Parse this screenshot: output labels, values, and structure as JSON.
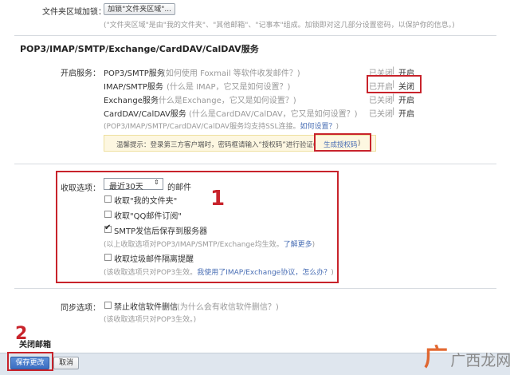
{
  "folder_encrypt": {
    "label": "文件夹区域加锁：",
    "button": "加锁\"文件夹区域\"...",
    "desc": "(\"文件夹区域\"是由\"我的文件夹\"、\"其他邮箱\"、\"记事本\"组成。加锁即对这几部分设置密码，以保护你的信息。)"
  },
  "protocol_section": {
    "title": "POP3/IMAP/SMTP/Exchange/CardDAV/CalDAV服务",
    "open_label": "开启服务：",
    "services": [
      {
        "name": "POP3/SMTP服务",
        "help": "(如何使用 Foxmail 等软件收发邮件？)",
        "status": "已关闭",
        "action": "开启"
      },
      {
        "name": "IMAP/SMTP服务",
        "help": "(什么是 IMAP，它又是如何设置？)",
        "status": "已开启",
        "action": "关闭"
      },
      {
        "name": "Exchange服务",
        "help": "(什么是Exchange，它又是如何设置？)",
        "status": "已关闭",
        "action": "开启"
      },
      {
        "name": "CardDAV/CalDAV服务",
        "help": "(什么是CardDAV/CalDAV，它又是如何设置？)",
        "status": "已关闭",
        "action": "开启"
      }
    ],
    "ssl_note": "(POP3/IMAP/SMTP/CardDAV/CalDAV服务均支持SSL连接。",
    "ssl_link": "如何设置？",
    "ssl_end": ")",
    "tip_prefix": "温馨提示：登录第三方客户端时，密码框请输入“授权码”进行验证(",
    "tip_link": "生成授权码",
    "tip_suffix": ")"
  },
  "receive_section": {
    "label": "收取选项：",
    "range_selected": "最近30天",
    "range_suffix": "的邮件",
    "options": [
      {
        "label": "收取\"我的文件夹\"",
        "checked": false
      },
      {
        "label": "收取\"QQ邮件订阅\"",
        "checked": false
      },
      {
        "label": "SMTP发信后保存到服务器",
        "checked": true
      }
    ],
    "note1": "(以上收取选项对POP3/IMAP/SMTP/Exchange均生效。",
    "note1_link": "了解更多",
    "note1_end": ")",
    "junk_label": "收取垃圾邮件隔离提醒",
    "note2": "(该收取选项只对POP3生效。",
    "note2_link": "我使用了IMAP/Exchange协议，怎么办？",
    "note2_end": ")"
  },
  "sync_section": {
    "label": "同步选项：",
    "option": "禁止收信软件删信",
    "help": "(为什么会有收信软件删信？)",
    "note": "(该收取选项只对POP3生效。)"
  },
  "close_mailbox": "关闭邮箱",
  "footer": {
    "save": "保存更改",
    "cancel": "取消"
  },
  "annotations": {
    "one": "1",
    "two": "2"
  },
  "watermark": {
    "text": "广西龙网"
  }
}
